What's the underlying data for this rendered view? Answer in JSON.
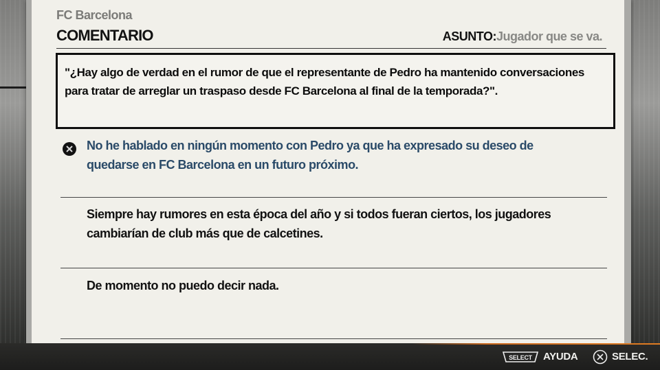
{
  "header": {
    "team": "FC Barcelona",
    "section": "COMENTARIO",
    "subject_label": "ASUNTO:",
    "subject_value": "Jugador que se va."
  },
  "question": "\"¿Hay algo de verdad en el rumor de que el representante de Pedro ha mantenido conversaciones para tratar de arreglar un traspaso desde FC Barcelona al final de la temporada?\".",
  "options": [
    {
      "text": "No he hablado en ningún momento con Pedro ya que ha expresado su deseo de quedarse en FC Barcelona en un futuro próximo.",
      "selected": true
    },
    {
      "text": "Siempre hay rumores en esta época del año y si todos fueran ciertos, los jugadores cambiarían de club más que de calcetines.",
      "selected": false
    },
    {
      "text": "De momento no puedo decir nada.",
      "selected": false
    }
  ],
  "footer": {
    "select_key": "SELECT",
    "help_label": "AYUDA",
    "confirm_label": "SELEC."
  },
  "colors": {
    "selected_text": "#2a4a68",
    "paper": "#f1f0ea",
    "accent": "#e07c22"
  }
}
